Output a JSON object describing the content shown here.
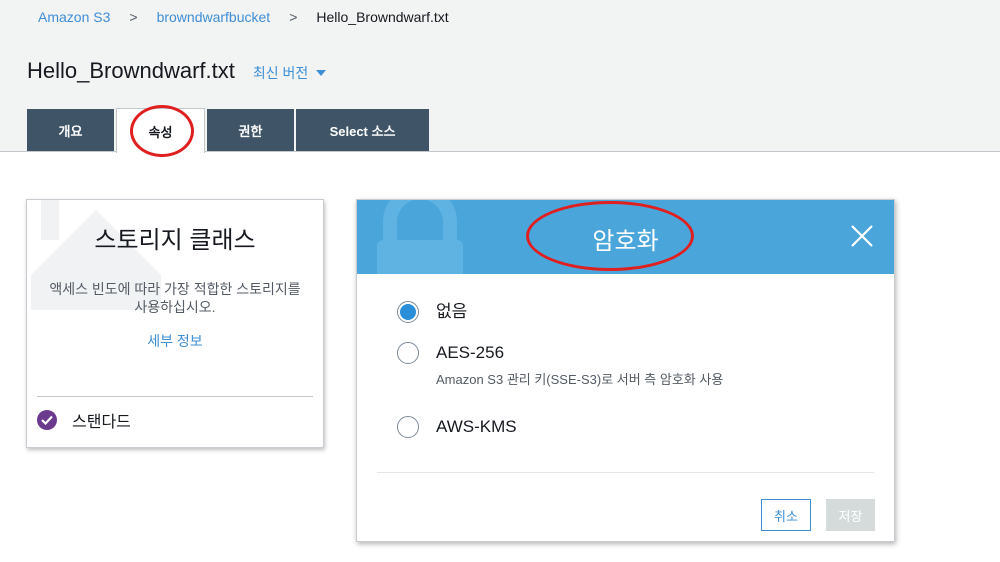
{
  "breadcrumb": {
    "items": [
      "Amazon S3",
      "browndwarfbucket"
    ],
    "separator": ">",
    "current": "Hello_Browndwarf.txt"
  },
  "header": {
    "title": "Hello_Browndwarf.txt",
    "version_label": "최신 버전"
  },
  "tabs": [
    {
      "label": "개요",
      "active": false
    },
    {
      "label": "속성",
      "active": true
    },
    {
      "label": "권한",
      "active": false
    },
    {
      "label": "Select 소스",
      "active": false
    }
  ],
  "storage_card": {
    "title": "스토리지 클래스",
    "description_lines": [
      "액세스 빈도에 따라 가장 적합한 스토리지를",
      "사용하십시오."
    ],
    "link": "세부 정보",
    "selected_value": "스탠다드"
  },
  "encryption_dialog": {
    "title": "암호화",
    "options": [
      {
        "label": "없음",
        "sublabel": "",
        "selected": true
      },
      {
        "label": "AES-256",
        "sublabel": "Amazon S3 관리 키(SSE-S3)로 서버 측 암호화 사용",
        "selected": false
      },
      {
        "label": "AWS-KMS",
        "sublabel": "",
        "selected": false
      }
    ],
    "cancel_label": "취소",
    "save_label": "저장"
  },
  "colors": {
    "accent": "#3f8fd5",
    "tab_bg": "#3f5567",
    "dialog_header": "#4aa5da",
    "check": "#6b3a8f",
    "annotation": "#e02020"
  }
}
